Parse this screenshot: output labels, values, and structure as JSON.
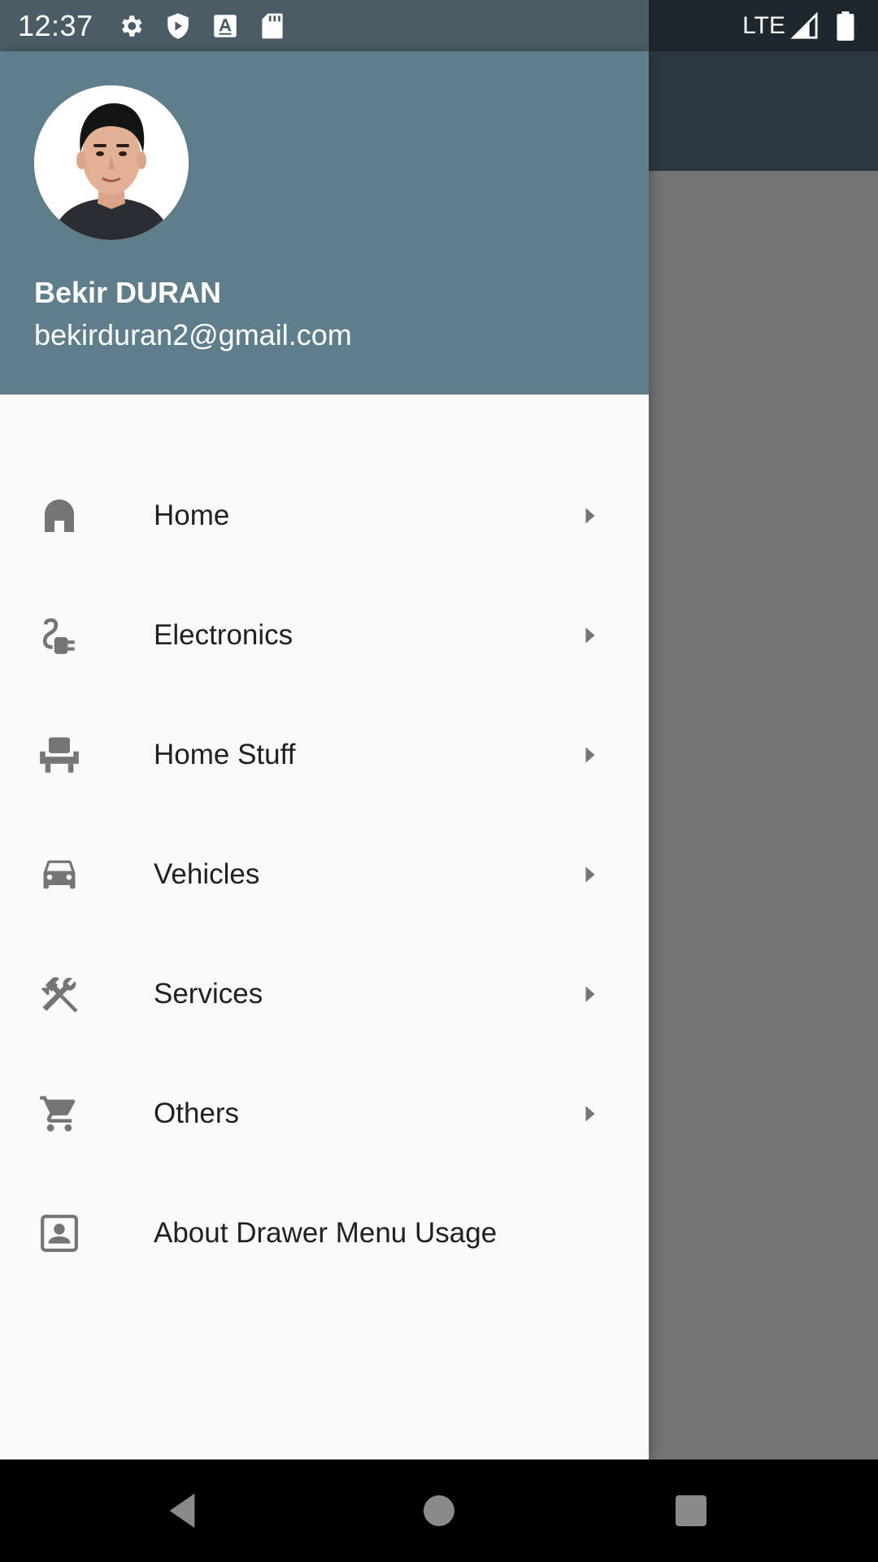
{
  "status_bar": {
    "time": "12:37",
    "network": "LTE",
    "icons": [
      "settings-icon",
      "shield-icon",
      "font-icon",
      "sd-card-icon",
      "signal-icon",
      "battery-icon"
    ]
  },
  "drawer": {
    "header": {
      "name": "Bekir DURAN",
      "email": "bekirduran2@gmail.com",
      "background_color": "#607d8b"
    },
    "items": [
      {
        "label": "Home",
        "icon": "home-icon",
        "has_arrow": true
      },
      {
        "label": "Electronics",
        "icon": "power-plug-icon",
        "has_arrow": true
      },
      {
        "label": "Home Stuff",
        "icon": "chair-icon",
        "has_arrow": true
      },
      {
        "label": "Vehicles",
        "icon": "car-icon",
        "has_arrow": true
      },
      {
        "label": "Services",
        "icon": "tools-icon",
        "has_arrow": true
      },
      {
        "label": "Others",
        "icon": "cart-icon",
        "has_arrow": true
      },
      {
        "label": "About Drawer Menu Usage",
        "icon": "contact-icon",
        "has_arrow": false
      }
    ]
  },
  "nav_bar": {
    "buttons": [
      "back-icon",
      "home-circle-icon",
      "recents-icon"
    ]
  },
  "colors": {
    "toolbar": "#2c3840",
    "scrim": "#747474",
    "icon": "#757575",
    "text": "#212121"
  }
}
